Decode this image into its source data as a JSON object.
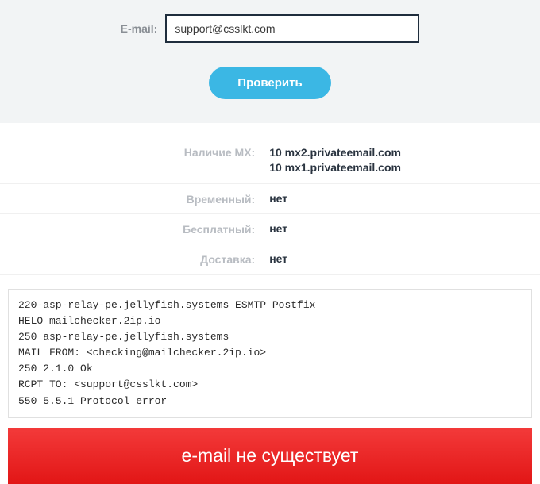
{
  "form": {
    "email_label": "E-mail:",
    "email_value": "support@csslkt.com",
    "check_button": "Проверить"
  },
  "results": {
    "mx_label": "Наличие MX:",
    "mx_records": [
      "10 mx2.privateemail.com",
      "10 mx1.privateemail.com"
    ],
    "temporary_label": "Временный:",
    "temporary_value": "нет",
    "free_label": "Бесплатный:",
    "free_value": "нет",
    "delivery_label": "Доставка:",
    "delivery_value": "нет"
  },
  "log": "220-asp-relay-pe.jellyfish.systems ESMTP Postfix\nHELO mailchecker.2ip.io\n250 asp-relay-pe.jellyfish.systems\nMAIL FROM: <checking@mailchecker.2ip.io>\n250 2.1.0 Ok\nRCPT TO: <support@csslkt.com>\n550 5.5.1 Protocol error",
  "status": {
    "message": "e-mail не существует"
  }
}
